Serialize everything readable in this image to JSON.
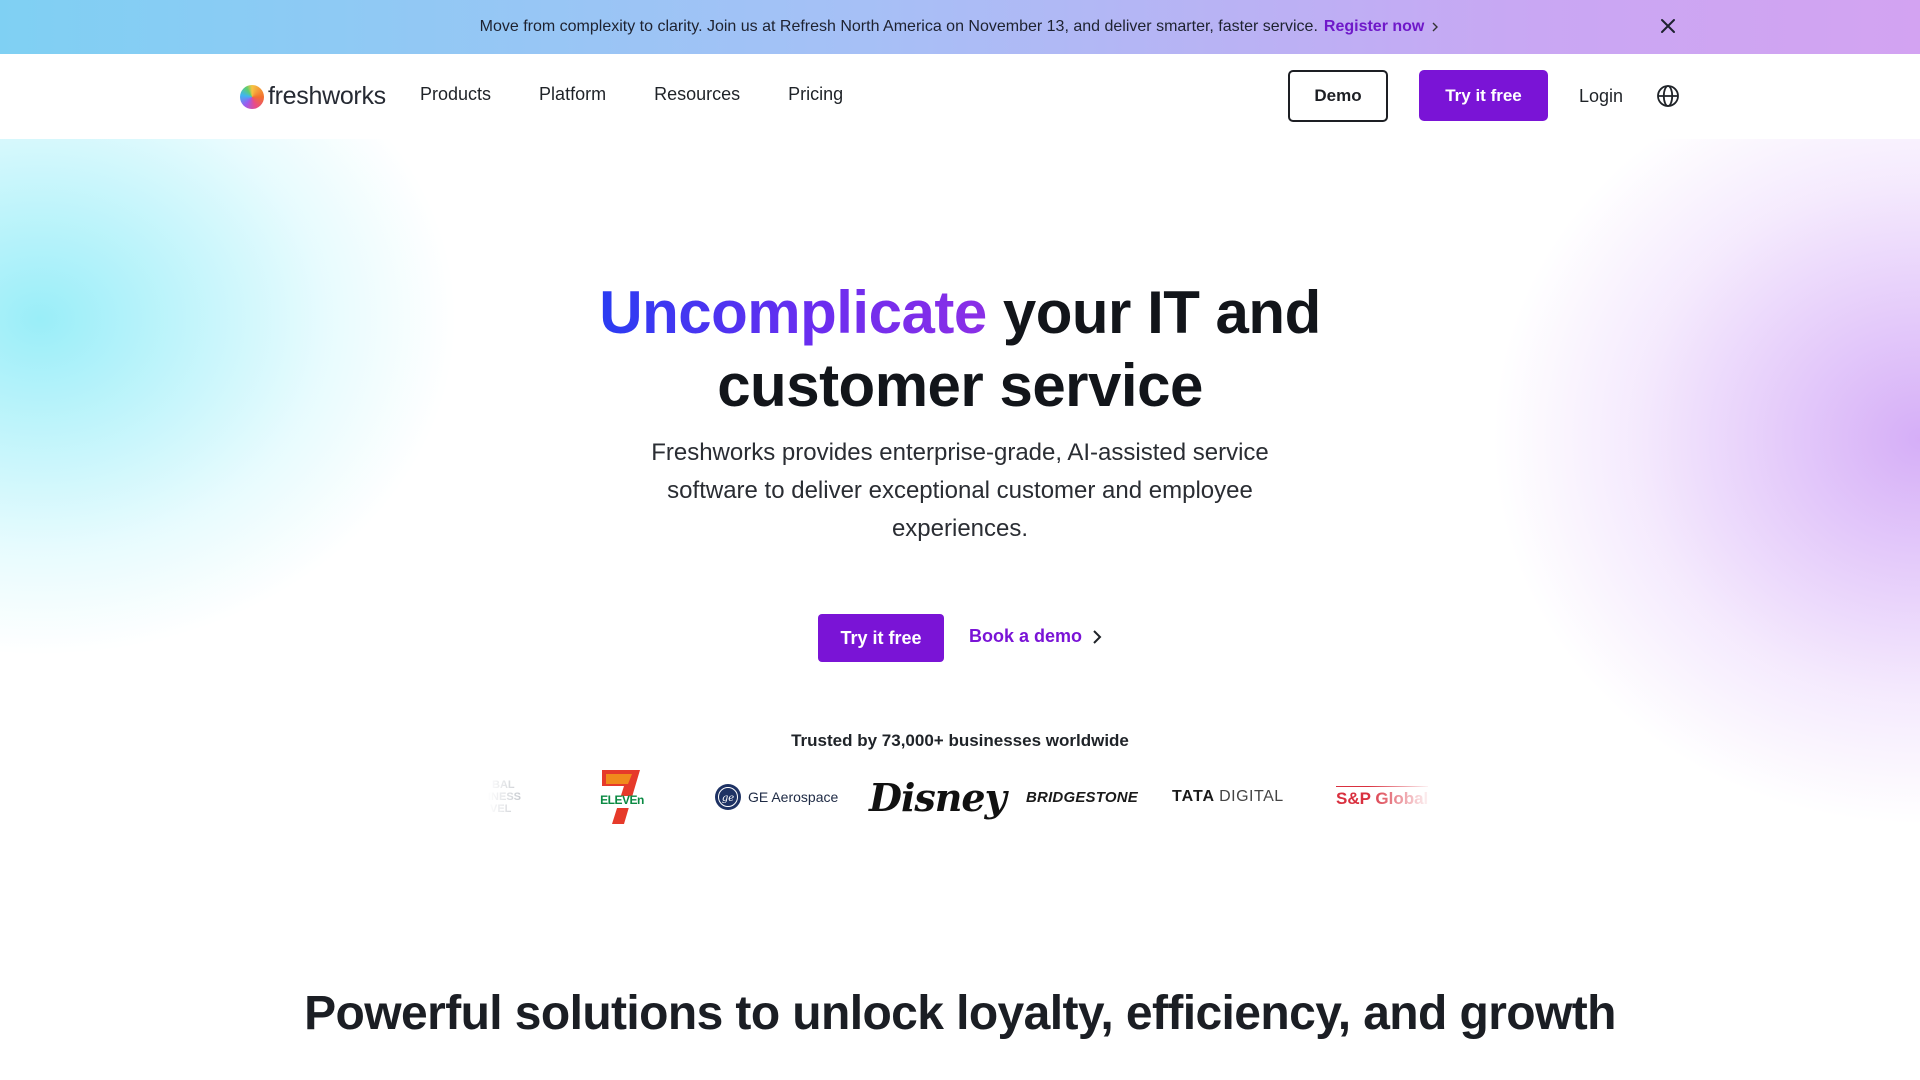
{
  "promo": {
    "message": "Move from complexity to clarity. Join us at Refresh North America on November 13, and deliver smarter, faster service.",
    "cta": "Register now"
  },
  "header": {
    "logo_text": "freshworks",
    "nav": [
      "Products",
      "Platform",
      "Resources",
      "Pricing"
    ],
    "demo_label": "Demo",
    "try_label": "Try it free",
    "login_label": "Login"
  },
  "hero": {
    "headline_highlight": "Uncomplicate",
    "headline_rest_line1": " your IT and",
    "headline_line2": "customer service",
    "subcopy": "Freshworks provides enterprise-grade, AI-assisted service software to deliver exceptional customer and employee experiences.",
    "try_label": "Try it free",
    "book_demo_label": "Book a demo",
    "trusted_text": "Trusted by 73,000+ businesses worldwide"
  },
  "customer_logos": {
    "partial_left": [
      "BAL",
      "INESS",
      "VEL"
    ],
    "seven_eleven": "ELEVEn",
    "ge": "GE Aerospace",
    "disney": "Disney",
    "bridgestone": "BRIDGESTONE",
    "tata_bold": "TATA",
    "tata_light": "DIGITAL",
    "sp": "S&P Global"
  },
  "solutions": {
    "heading": "Powerful solutions to unlock loyalty, efficiency, and growth"
  },
  "colors": {
    "brand_purple": "#7a14d6",
    "text_dark": "#12151a"
  }
}
